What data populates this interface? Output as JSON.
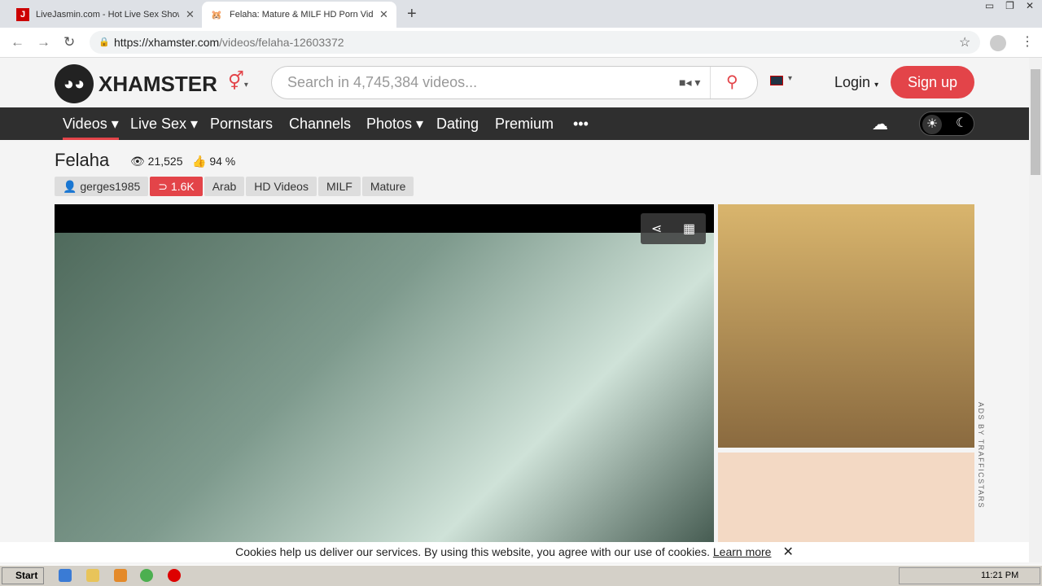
{
  "browser": {
    "tabs": [
      {
        "title": "LiveJasmin.com - Hot Live Sex Shows",
        "icon": "J",
        "active": false
      },
      {
        "title": "Felaha: Mature & MILF HD Porn Video",
        "icon": "hamster-icon",
        "active": true
      }
    ],
    "url_host": "https://xhamster.com",
    "url_path": "/videos/felaha-12603372"
  },
  "header": {
    "logo": "XHAMSTER",
    "search_placeholder": "Search in 4,745,384 videos...",
    "login": "Login",
    "signup": "Sign up"
  },
  "menu": [
    {
      "label": "Videos ▾",
      "active": true
    },
    {
      "label": "Live Sex ▾"
    },
    {
      "label": "Pornstars"
    },
    {
      "label": "Channels"
    },
    {
      "label": "Photos ▾"
    },
    {
      "label": "Dating"
    },
    {
      "label": "Premium"
    },
    {
      "label": "•••"
    }
  ],
  "video": {
    "title": "Felaha",
    "views": "21,525",
    "rating": "94 %",
    "uploader": "gerges1985",
    "subscribers": "1.6K",
    "tags": [
      "Arab",
      "HD Videos",
      "MILF",
      "Mature"
    ]
  },
  "ads": {
    "label": "ADS BY TRAFFICSTARS"
  },
  "cookie": {
    "text": "Cookies help us deliver our services. By using this website, you agree with our use of cookies.",
    "link": "Learn more"
  },
  "taskbar": {
    "start": "Start",
    "time": "11:21 PM"
  },
  "colors": {
    "accent": "#e34449",
    "menubar": "#2f2f2f"
  }
}
